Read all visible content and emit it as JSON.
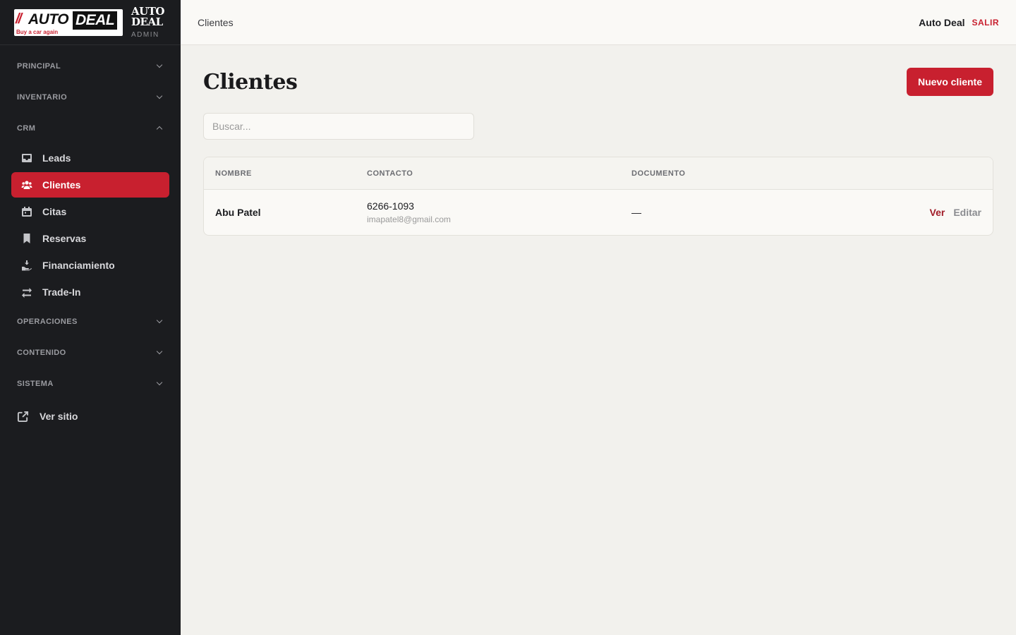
{
  "brand": {
    "logo_slash": "//",
    "logo_auto": "AUTO",
    "logo_deal": "DEAL",
    "logo_tagline": "Buy a car again",
    "title_line1": "AUTO",
    "title_line2": "DEAL",
    "subtitle": "ADMIN"
  },
  "sidebar": {
    "sections": {
      "principal": "PRINCIPAL",
      "inventario": "INVENTARIO",
      "crm": "CRM",
      "operaciones": "OPERACIONES",
      "contenido": "CONTENIDO",
      "sistema": "SISTEMA"
    },
    "crm_items": [
      {
        "label": "Leads",
        "icon": "inbox-icon"
      },
      {
        "label": "Clientes",
        "icon": "users-icon",
        "active": true
      },
      {
        "label": "Citas",
        "icon": "calendar-icon"
      },
      {
        "label": "Reservas",
        "icon": "bookmark-icon"
      },
      {
        "label": "Financiamiento",
        "icon": "hand-coins-icon"
      },
      {
        "label": "Trade-In",
        "icon": "exchange-icon"
      }
    ],
    "external_link": "Ver sitio"
  },
  "topbar": {
    "breadcrumb": "Clientes",
    "user_name": "Auto Deal",
    "logout": "SALIR"
  },
  "main": {
    "title": "Clientes",
    "new_button": "Nuevo cliente",
    "search_placeholder": "Buscar...",
    "table": {
      "headers": {
        "name": "NOMBRE",
        "contact": "CONTACTO",
        "document": "DOCUMENTO"
      },
      "rows": [
        {
          "name": "Abu Patel",
          "phone": "6266-1093",
          "email": "imapatel8@gmail.com",
          "document": "—",
          "view": "Ver",
          "edit": "Editar"
        }
      ]
    }
  },
  "colors": {
    "accent": "#c8202f",
    "sidebar_bg": "#1b1c1f",
    "page_bg": "#f2f1ed"
  }
}
